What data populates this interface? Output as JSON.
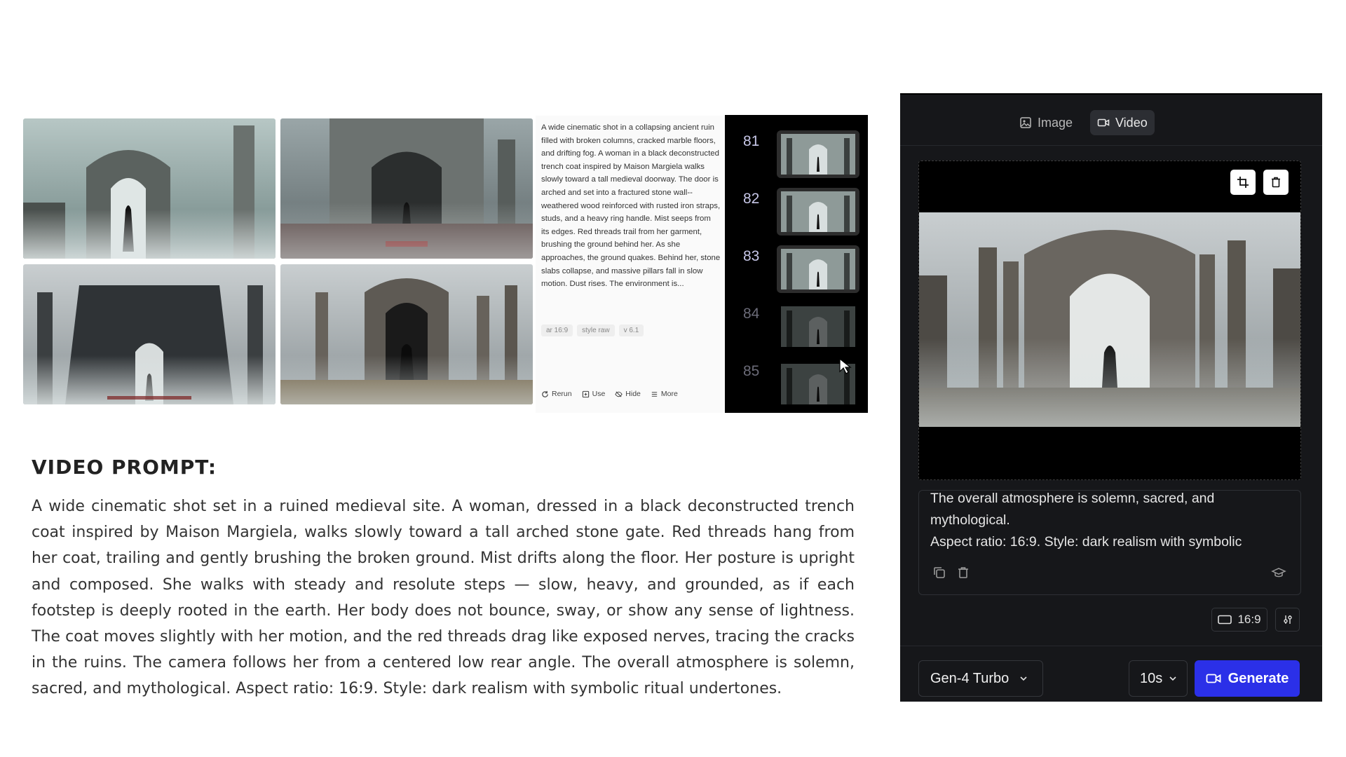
{
  "prompt_card": {
    "text": "A wide cinematic shot in a collapsing ancient ruin filled with broken columns, cracked marble floors, and drifting fog. A woman in a black deconstructed trench coat inspired by Maison Margiela walks slowly toward a tall medieval doorway. The door is arched and set into a fractured stone wall--weathered wood reinforced with rusted iron straps, studs, and a heavy ring handle. Mist seeps from its edges. Red threads trail from her garment, brushing the ground behind her. As she approaches, the ground quakes. Behind her, stone slabs collapse, and massive pillars fall in slow motion. Dust rises. The environment is...",
    "tags": [
      "ar 16:9",
      "style raw",
      "v 6.1"
    ],
    "actions": {
      "rerun": "Rerun",
      "use": "Use",
      "hide": "Hide",
      "more": "More"
    }
  },
  "strip": {
    "items": [
      "81",
      "82",
      "83",
      "84",
      "85"
    ]
  },
  "video_prompt": {
    "heading": "VIDEO PROMPT:",
    "body": "A wide cinematic shot set in a ruined medieval site. A woman, dressed in a black deconstructed trench coat inspired by Maison Margiela, walks slowly toward a tall arched stone gate. Red threads hang from her coat, trailing and gently brushing the broken ground. Mist drifts along the floor. Her posture is upright and composed. She walks with steady and resolute steps — slow, heavy, and grounded, as if each footstep is deeply rooted in the earth. Her body does not bounce, sway, or show any sense of lightness. The coat moves slightly with her motion, and the red threads drag like exposed nerves, tracing the cracks in the ruins. The camera follows her from a centered low rear angle. The overall atmosphere is solemn, sacred, and mythological. Aspect ratio: 16:9. Style: dark realism with symbolic ritual undertones."
  },
  "app": {
    "tabs": {
      "image": "Image",
      "video": "Video"
    },
    "active_tab": "Video",
    "prompt_text": "The overall atmosphere is solemn, sacred, and mythological.\nAspect ratio: 16:9. Style: dark realism with symbolic",
    "aspect_ratio": "16:9",
    "model": "Gen-4 Turbo",
    "duration": "10s",
    "generate_label": "Generate",
    "icons": {
      "image_tab": "image-icon",
      "video_tab": "video-camera-icon",
      "crop": "crop-icon",
      "delete": "trash-icon",
      "copy": "copy-icon",
      "enhance": "graduation-cap-icon",
      "ratio": "aspect-ratio-icon",
      "settings": "sliders-icon",
      "generate": "video-camera-icon"
    },
    "colors": {
      "panel_bg": "#16171a",
      "generate_bg": "#2b30e8"
    }
  }
}
